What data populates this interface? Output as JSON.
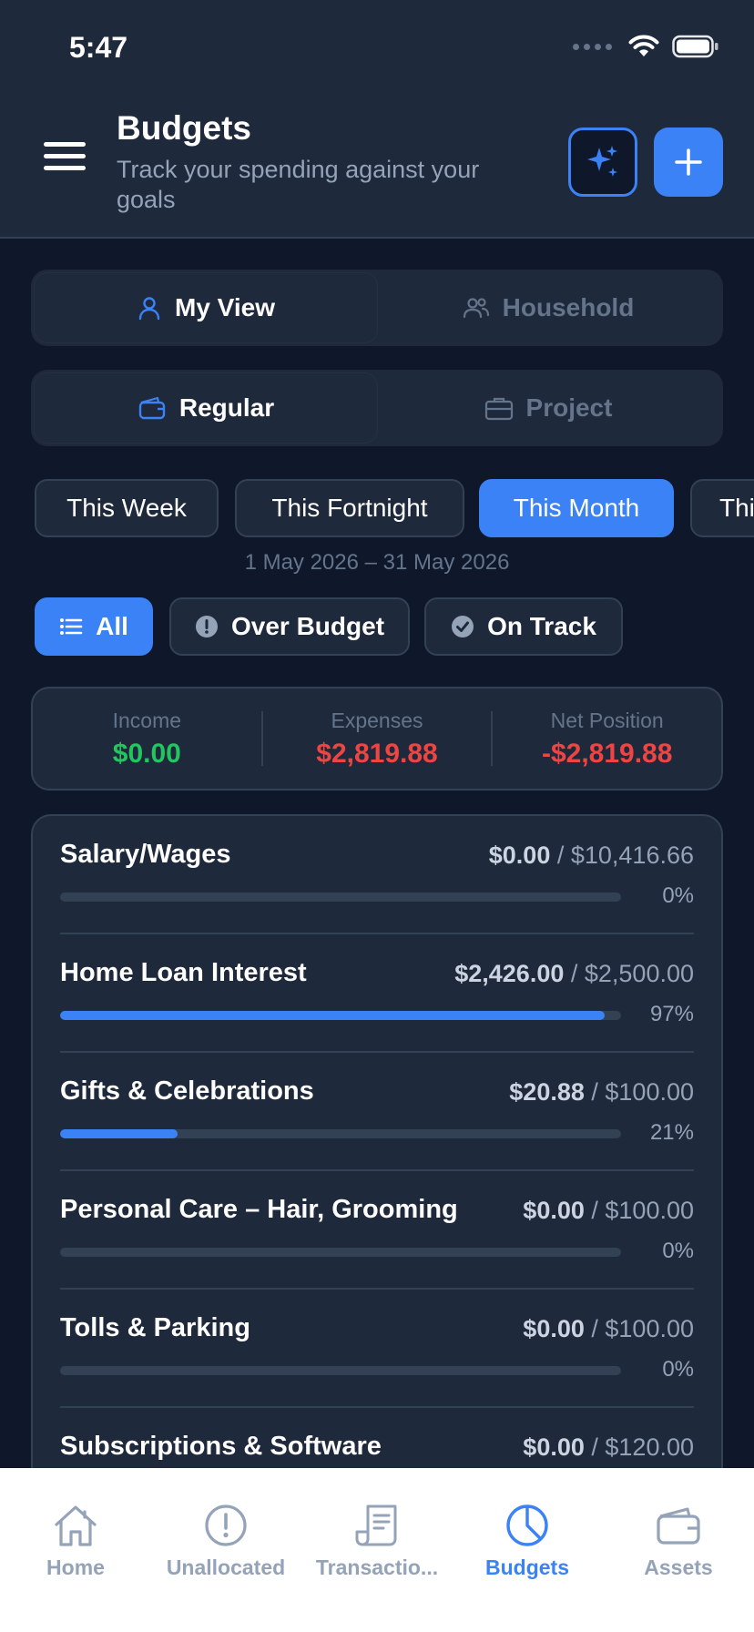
{
  "status_bar": {
    "time": "5:47"
  },
  "header": {
    "title": "Budgets",
    "subtitle": "Track your spending against your goals",
    "ai_icon": "sparkles-icon",
    "add_icon": "plus-icon"
  },
  "view_toggle": {
    "options": [
      "My View",
      "Household"
    ],
    "selected": "My View"
  },
  "type_toggle": {
    "options": [
      "Regular",
      "Project"
    ],
    "selected": "Regular"
  },
  "periods": {
    "options": [
      "This Week",
      "This Fortnight",
      "This Month",
      "This Year"
    ],
    "selected": "This Month"
  },
  "date_range": "1 May 2026 – 31 May 2026",
  "filters": {
    "options": [
      "All",
      "Over Budget",
      "On Track"
    ],
    "selected": "All"
  },
  "summary": {
    "income_label": "Income",
    "income_value": "$0.00",
    "expenses_label": "Expenses",
    "expenses_value": "$2,819.88",
    "net_label": "Net Position",
    "net_value": "-$2,819.88"
  },
  "colors": {
    "accent": "#3b82f6",
    "positive": "#22c55e",
    "negative": "#ef4444",
    "background": "#0f172a",
    "surface": "#1e293b"
  },
  "budgets": [
    {
      "name": "Salary/Wages",
      "spent": "$0.00",
      "limit": "$10,416.66",
      "percent": "0%",
      "progress": 0
    },
    {
      "name": "Home Loan Interest",
      "spent": "$2,426.00",
      "limit": "$2,500.00",
      "percent": "97%",
      "progress": 0.97
    },
    {
      "name": "Gifts & Celebrations",
      "spent": "$20.88",
      "limit": "$100.00",
      "percent": "21%",
      "progress": 0.21
    },
    {
      "name": "Personal Care – Hair, Grooming",
      "spent": "$0.00",
      "limit": "$100.00",
      "percent": "0%",
      "progress": 0
    },
    {
      "name": "Tolls & Parking",
      "spent": "$0.00",
      "limit": "$100.00",
      "percent": "0%",
      "progress": 0
    },
    {
      "name": "Subscriptions & Software",
      "spent": "$0.00",
      "limit": "$120.00",
      "percent": "",
      "progress": 0
    }
  ],
  "tab_bar": {
    "items": [
      {
        "label": "Home",
        "icon": "home-icon"
      },
      {
        "label": "Unallocated",
        "icon": "alert-circle-icon"
      },
      {
        "label": "Transactio...",
        "icon": "receipt-icon"
      },
      {
        "label": "Budgets",
        "icon": "pie-chart-icon"
      },
      {
        "label": "Assets",
        "icon": "wallet-icon"
      }
    ],
    "selected": "Budgets"
  }
}
